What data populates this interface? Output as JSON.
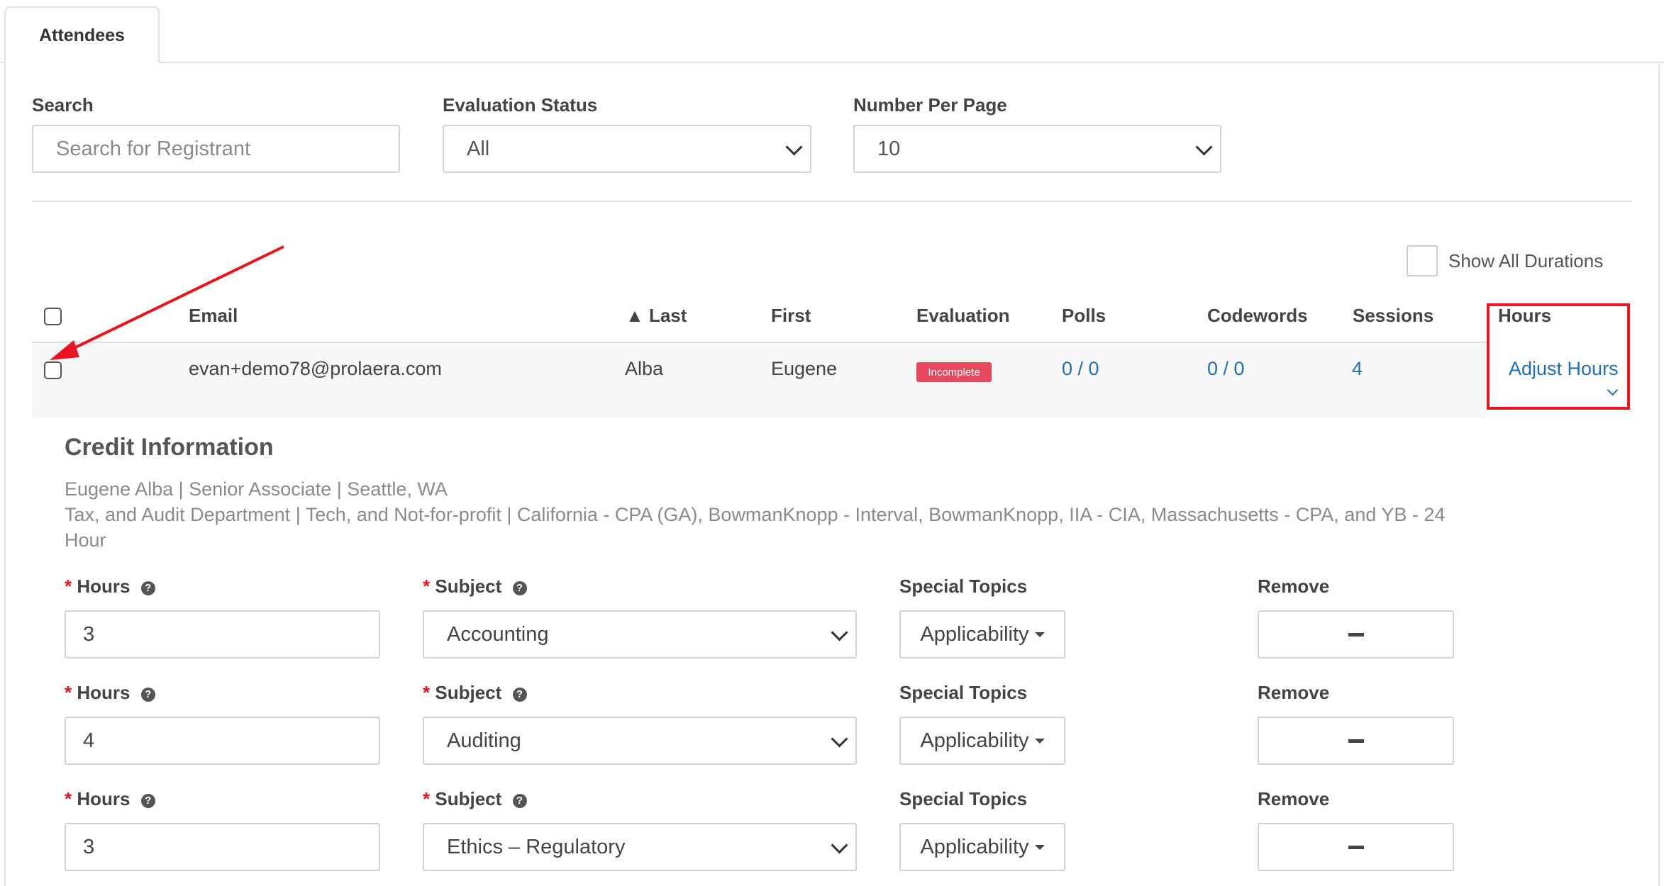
{
  "tabs": [
    {
      "label": "Attendees"
    }
  ],
  "filters": {
    "search_label": "Search",
    "search_placeholder": "Search for Registrant",
    "eval_label": "Evaluation Status",
    "eval_value": "All",
    "per_page_label": "Number Per Page",
    "per_page_value": "10"
  },
  "show_all_durations": "Show All Durations",
  "table": {
    "headers": {
      "email": "Email",
      "last": "▲ Last",
      "first": "First",
      "evaluation": "Evaluation",
      "polls": "Polls",
      "codewords": "Codewords",
      "sessions": "Sessions",
      "hours": "Hours"
    },
    "rows": [
      {
        "email": "evan+demo78@prolaera.com",
        "last": "Alba",
        "first": "Eugene",
        "evaluation": "Incomplete",
        "polls": "0 / 0",
        "codewords": "0 / 0",
        "sessions": "4",
        "hours": "Adjust Hours"
      }
    ]
  },
  "credit": {
    "title": "Credit Information",
    "line1": "Eugene Alba | Senior Associate | Seattle, WA",
    "line2": "Tax, and Audit Department | Tech, and Not-for-profit | California - CPA (GA), BowmanKnopp - Interval, BowmanKnopp, IIA - CIA, Massachusetts - CPA, and YB - 24",
    "line3": "Hour",
    "labels": {
      "required": "*",
      "hours": "Hours",
      "subject": "Subject",
      "special_topics": "Special Topics",
      "remove": "Remove",
      "applicability": "Applicability",
      "help_glyph": "?"
    },
    "entries": [
      {
        "hours": "3",
        "subject": "Accounting"
      },
      {
        "hours": "4",
        "subject": "Auditing"
      },
      {
        "hours": "3",
        "subject": "Ethics – Regulatory"
      }
    ]
  },
  "colors": {
    "accent_link": "#1f6fb2",
    "badge": "#e8485f",
    "highlight": "#e8141f"
  }
}
